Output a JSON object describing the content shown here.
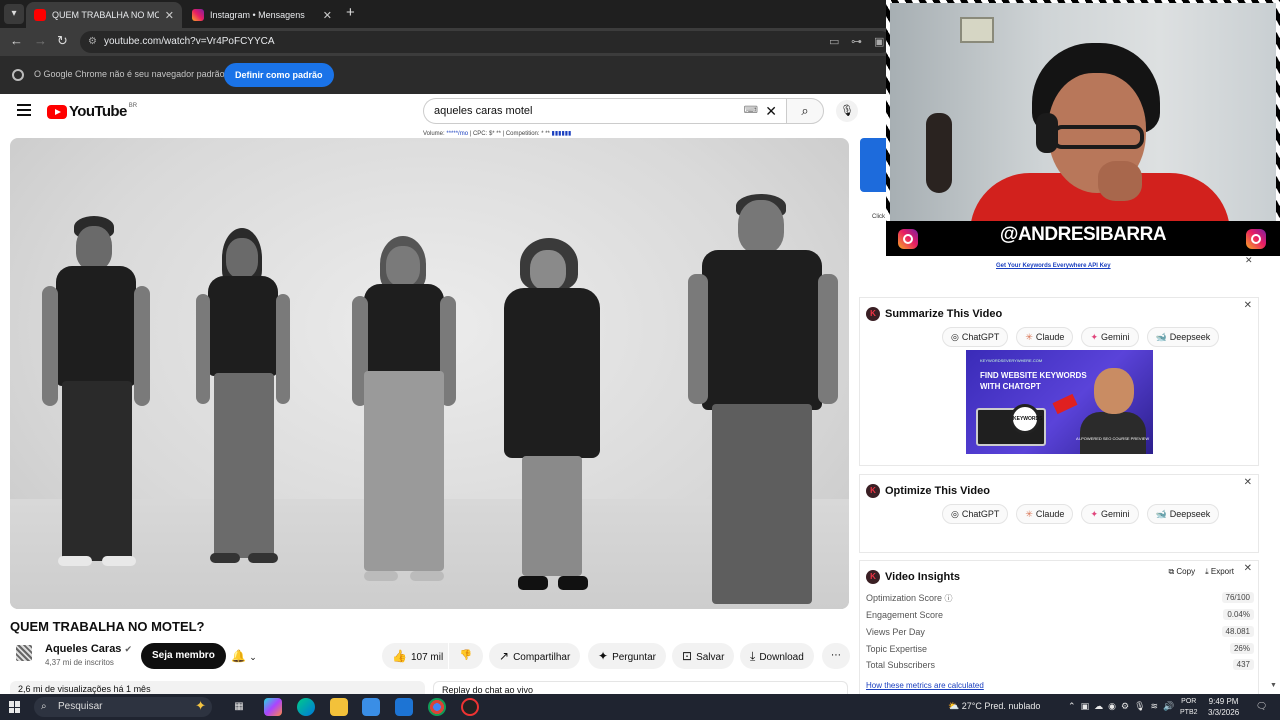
{
  "browser": {
    "tabs": [
      {
        "title": "QUEM TRABALHA NO MOTEL?",
        "active": true,
        "favicon_color": "#ff0000"
      },
      {
        "title": "Instagram • Mensagens",
        "active": false,
        "favicon_color": "#e1306c"
      }
    ],
    "url": "youtube.com/watch?v=Vr4PoFCYYCA",
    "infobar": {
      "message": "O Google Chrome não é seu navegador padrão",
      "button": "Definir como padrão"
    }
  },
  "youtube": {
    "logo_text": "YouTube",
    "country_code": "BR",
    "search_value": "aqueles caras motel",
    "keyword_line": {
      "volume_label": "Volume:",
      "volume_value": "*****/mo",
      "rest": "| CPC: $* ** | Competition: * **"
    },
    "video": {
      "title": "QUEM TRABALHA NO MOTEL?",
      "channel": "Aqueles Caras",
      "subscribers": "4,37 mi de inscritos",
      "member_button": "Seja membro",
      "likes": "107 mil",
      "share": "Compartilhar",
      "ask": "Perguntar",
      "save": "Salvar",
      "download": "Download",
      "views_line": "2,6 mi de visualizações  há 1 mês",
      "chat_replay": "Replay do chat ao vivo"
    }
  },
  "sidebar": {
    "side_cut_text": "Click",
    "keywords_link": "Get Your Keywords Everywhere API Key",
    "summarize": {
      "title": "Summarize This Video",
      "ai_buttons": [
        "ChatGPT",
        "Claude",
        "Gemini",
        "Deepseek"
      ],
      "promo": {
        "header": "KEYWORDSEVERYWHERE.COM",
        "headline": "FIND WEBSITE KEYWORDS WITH CHATGPT",
        "lens": "KEYWORDS",
        "footer": "AI-POWERED SEO COURSE PREVIEW"
      }
    },
    "optimize": {
      "title": "Optimize This Video",
      "ai_buttons": [
        "ChatGPT",
        "Claude",
        "Gemini",
        "Deepseek"
      ]
    },
    "insights": {
      "title": "Video Insights",
      "copy": "Copy",
      "export": "Export",
      "metrics": [
        {
          "label": "Optimization Score",
          "value": "76/100"
        },
        {
          "label": "Engagement Score",
          "value": "0.04%"
        },
        {
          "label": "Views Per Day",
          "value": "48.081"
        },
        {
          "label": "Topic Expertise",
          "value": "26%"
        },
        {
          "label": "Total Subscribers",
          "value": "437"
        }
      ],
      "link": "How these metrics are calculated"
    }
  },
  "webcam": {
    "handle": "@ANDRESIBARRA"
  },
  "taskbar": {
    "search_placeholder": "Pesquisar",
    "weather": "27°C  Pred. nublado",
    "lang_top": "POR",
    "lang_bottom": "PTB2",
    "time": "9:49 PM",
    "date": "3/3/2026"
  },
  "colors": {
    "youtube_red": "#ff0000",
    "chrome_blue": "#1a73e8",
    "link_blue": "#1a3fbf",
    "webcam_shirt": "#d2211d"
  }
}
